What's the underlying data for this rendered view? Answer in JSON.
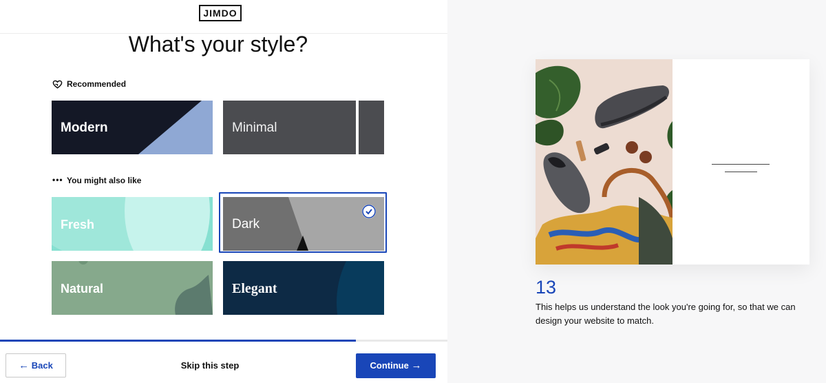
{
  "header": {
    "logo_text": "JIMDO"
  },
  "page_title": "What's your style?",
  "recommended": {
    "label": "Recommended",
    "icon": "heart-icon",
    "tiles": [
      {
        "label": "Modern",
        "colors": [
          "#141826",
          "#8fa8d4"
        ]
      },
      {
        "label": "Minimal",
        "colors": [
          "#4b4c50"
        ]
      }
    ]
  },
  "also_like": {
    "label": "You might also like",
    "icon": "ellipsis-icon",
    "tiles": [
      {
        "label": "Fresh",
        "colors": [
          "#86e0d1",
          "#b8efe6"
        ]
      },
      {
        "label": "Dark",
        "colors": [
          "#707070",
          "#a6a6a6"
        ],
        "selected": true
      },
      {
        "label": "Natural",
        "colors": [
          "#86a98c",
          "#5c7b6e"
        ]
      },
      {
        "label": "Elegant",
        "colors": [
          "#0d2a45",
          "#083b5c"
        ]
      }
    ]
  },
  "progress": {
    "fraction": 0.795
  },
  "footer": {
    "back_label": "Back",
    "skip_label": "Skip this step",
    "continue_label": "Continue"
  },
  "preview": {
    "step_number": "13",
    "help_text": "This helps us understand the look you're going for, so that we can design your website to match."
  },
  "colors": {
    "accent": "#1946b8"
  }
}
